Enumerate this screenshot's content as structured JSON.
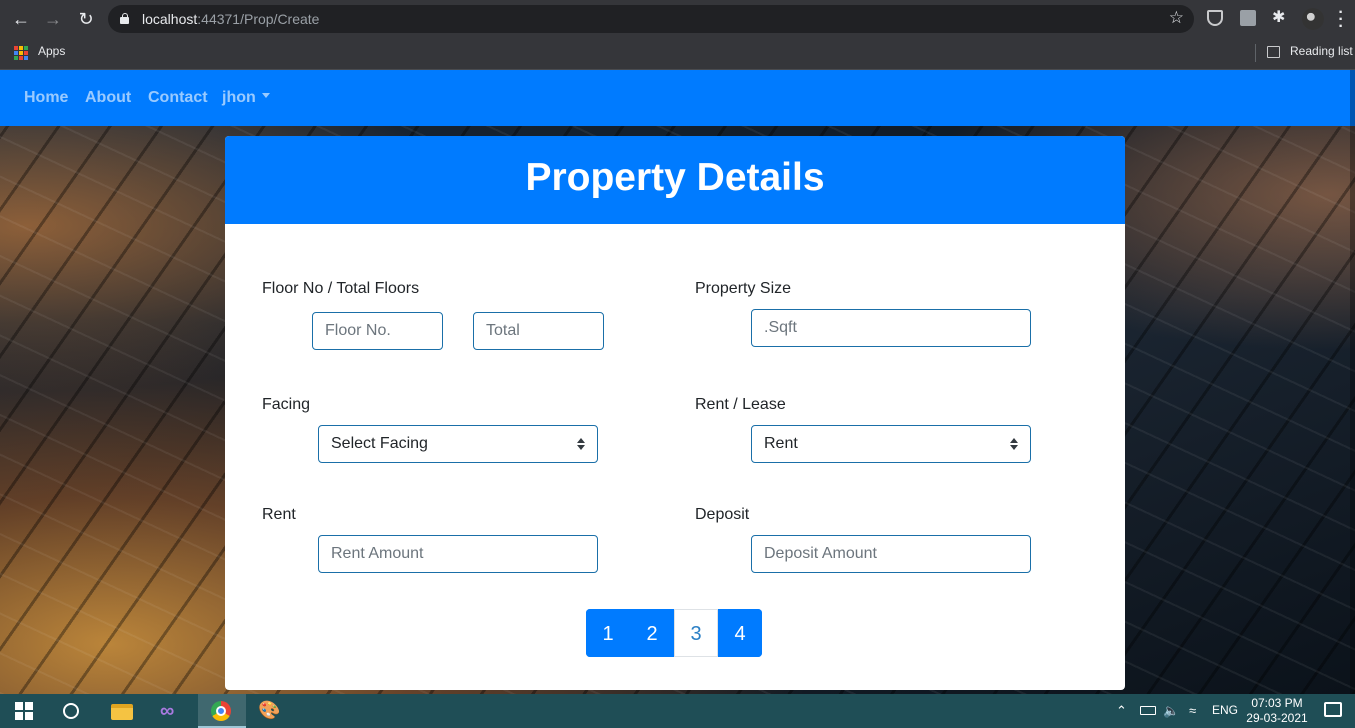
{
  "browser": {
    "url_host": "localhost",
    "url_path": ":44371/Prop/Create",
    "bookmarks": {
      "apps_label": "Apps",
      "reading_list_label": "Reading list"
    }
  },
  "navbar": {
    "links": [
      "Home",
      "About",
      "Contact"
    ],
    "user_menu": "jhon"
  },
  "form": {
    "title": "Property Details",
    "floor_label": "Floor No / Total Floors",
    "floor_no_placeholder": "Floor No.",
    "total_placeholder": "Total",
    "size_label": "Property Size",
    "size_placeholder": ".Sqft",
    "facing_label": "Facing",
    "facing_selected": "Select Facing",
    "rent_lease_label": "Rent / Lease",
    "rent_lease_selected": "Rent",
    "rent_label": "Rent",
    "rent_placeholder": "Rent Amount",
    "deposit_label": "Deposit",
    "deposit_placeholder": "Deposit Amount"
  },
  "pagination": [
    "1",
    "2",
    "3",
    "4"
  ],
  "taskbar": {
    "language": "ENG",
    "time": "07:03 PM",
    "date": "29-03-2021"
  },
  "colors": {
    "primary": "#007bff",
    "taskbar": "#1f4e56"
  }
}
